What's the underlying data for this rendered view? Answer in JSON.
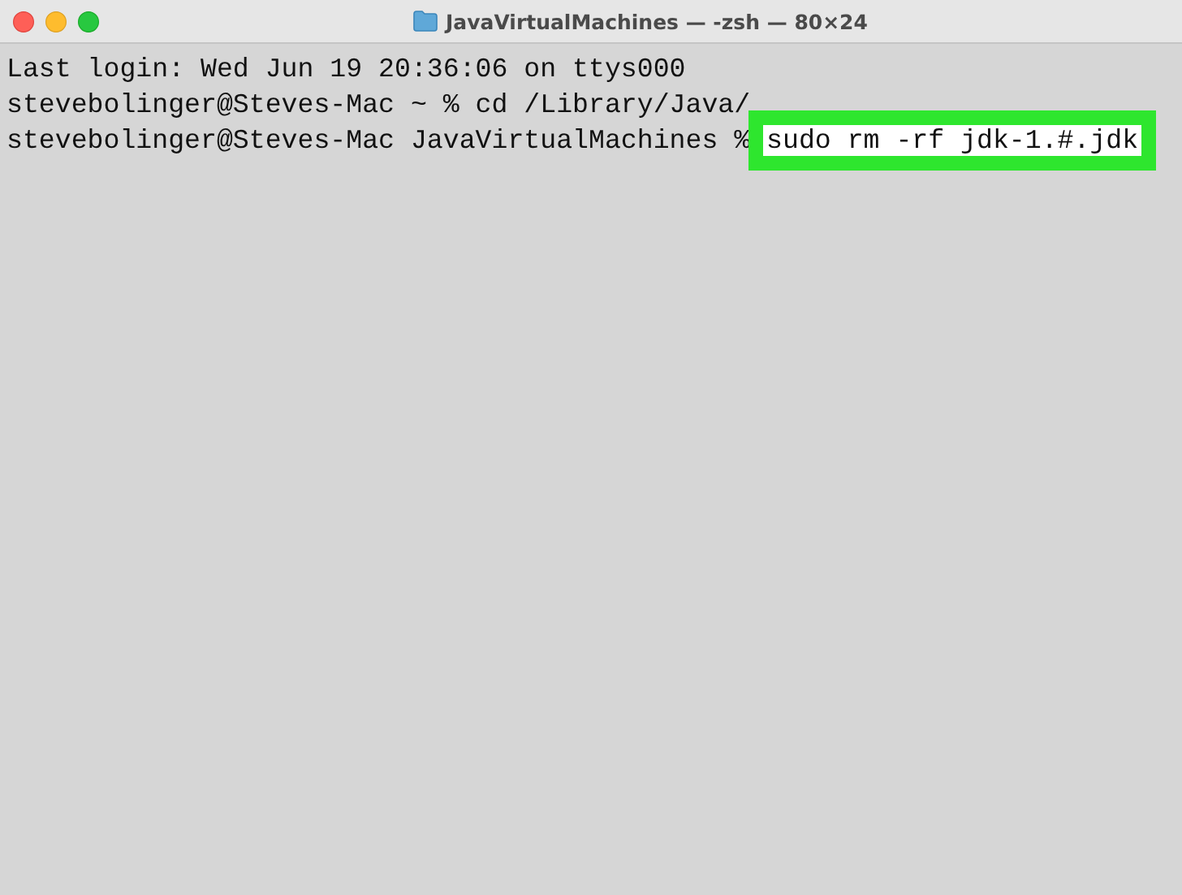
{
  "window": {
    "title": "JavaVirtualMachines — -zsh — 80×24"
  },
  "terminal": {
    "lines": [
      {
        "kind": "output",
        "text": "Last login: Wed Jun 19 20:36:06 on ttys000"
      },
      {
        "kind": "command",
        "prompt": "stevebolinger@Steves-Mac ~ % ",
        "command": "cd /Library/Java/",
        "highlighted": false
      },
      {
        "kind": "command",
        "prompt": "stevebolinger@Steves-Mac JavaVirtualMachines % ",
        "command": "sudo rm -rf jdk-1.#.jdk",
        "highlighted": true
      }
    ]
  }
}
